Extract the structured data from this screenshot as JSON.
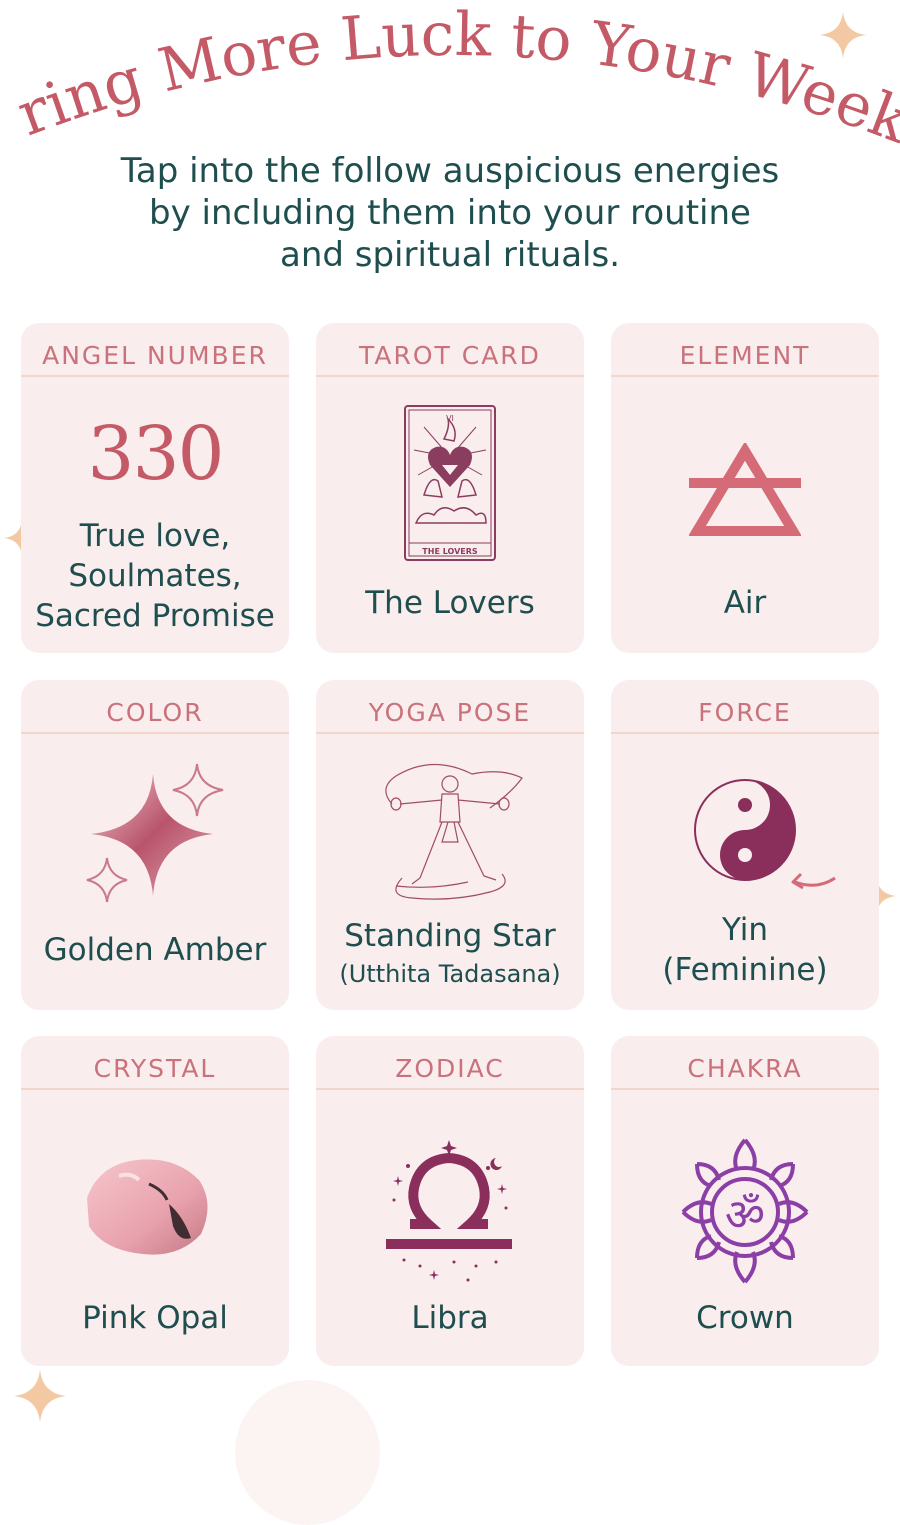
{
  "header": {
    "title": "Bring More Luck to Your Week!",
    "subtitle_lines": [
      "Tap into the follow auspicious energies",
      "by including them into your routine",
      "and spiritual rituals."
    ]
  },
  "colors": {
    "title": "#c55a67",
    "heading": "#c9727b",
    "text": "#1f4e4f",
    "card_bg": "#f9edee",
    "accent_purple": "#8a3d7a",
    "sparkle": "#f2c9a3"
  },
  "cards": [
    {
      "heading": "ANGEL NUMBER",
      "number": "330",
      "value_lines": [
        "True love,",
        "Soulmates,",
        "Sacred Promise"
      ],
      "icon": "angel-number"
    },
    {
      "heading": "TAROT CARD",
      "card_numeral": "VI",
      "card_caption": "THE LOVERS",
      "value": "The Lovers",
      "icon": "tarot-card-icon"
    },
    {
      "heading": "ELEMENT",
      "value": "Air",
      "icon": "air-element-icon"
    },
    {
      "heading": "COLOR",
      "value": "Golden Amber",
      "icon": "sparkle-stars-icon"
    },
    {
      "heading": "YOGA POSE",
      "value": "Standing Star",
      "sub": "(Utthita Tadasana)",
      "icon": "yoga-pose-icon"
    },
    {
      "heading": "FORCE",
      "value_lines": [
        "Yin",
        "(Feminine)"
      ],
      "icon": "yin-yang-icon"
    },
    {
      "heading": "CRYSTAL",
      "value": "Pink Opal",
      "icon": "crystal-icon"
    },
    {
      "heading": "ZODIAC",
      "value": "Libra",
      "icon": "libra-icon"
    },
    {
      "heading": "CHAKRA",
      "value": "Crown",
      "icon": "crown-chakra-icon"
    }
  ]
}
